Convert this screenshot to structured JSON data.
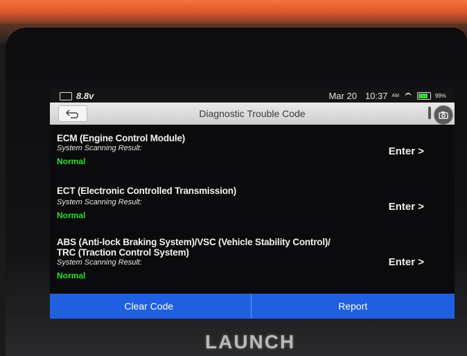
{
  "status_bar": {
    "voltage": "8.8v",
    "date": "Mar 20",
    "time": "10:37",
    "ampm": "AM",
    "battery": "99%"
  },
  "header": {
    "title": "Diagnostic Trouble Code"
  },
  "modules": [
    {
      "name": "ECM (Engine Control Module)",
      "name_line2": "",
      "scan_label": "System Scanning Result:",
      "status": "Normal",
      "enter_label": "Enter >"
    },
    {
      "name": "ECT (Electronic Controlled Transmission)",
      "name_line2": "",
      "scan_label": "System Scanning Result:",
      "status": "Normal",
      "enter_label": "Enter >"
    },
    {
      "name": "ABS (Anti-lock Braking System)/VSC (Vehicle Stability Control)/",
      "name_line2": "TRC (Traction Control System)",
      "scan_label": "System Scanning Result:",
      "status": "Normal",
      "enter_label": "Enter >"
    }
  ],
  "actions": {
    "clear_code": "Clear Code",
    "report": "Report"
  },
  "device": {
    "brand": "LAUNCH"
  },
  "colors": {
    "status_normal": "#29e02b",
    "action_bar": "#1f5fe0"
  }
}
